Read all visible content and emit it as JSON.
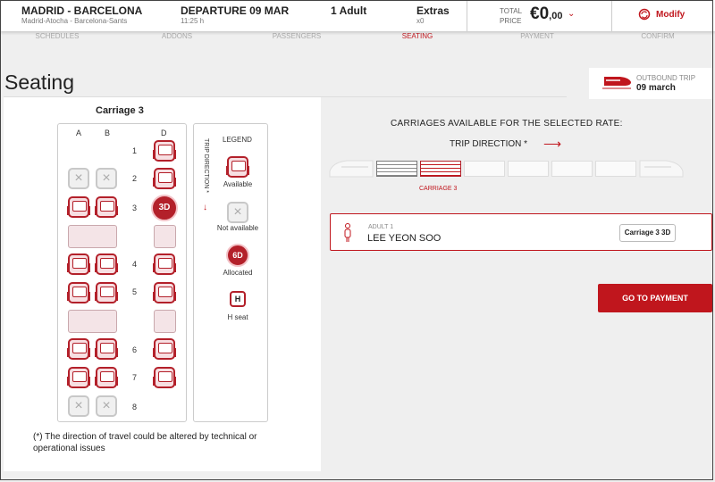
{
  "topbar": {
    "route_title": "MADRID - BARCELONA",
    "route_sub": "Madrid-Atocha - Barcelona-Sants",
    "departure_title": "DEPARTURE 09 MAR",
    "departure_time": "11:25 h",
    "passengers": "1 Adult",
    "extras_title": "Extras",
    "extras_count": "x0",
    "total_label_1": "TOTAL",
    "total_label_2": "PRICE",
    "price_main": "€0",
    "price_cents": ",00",
    "modify_label": "Modify"
  },
  "steps": [
    "SCHEDULES",
    "ADDONS",
    "PASSENGERS",
    "SEATING",
    "PAYMENT",
    "CONFIRM"
  ],
  "active_step": "SEATING",
  "page": {
    "title": "Seating",
    "outbound_label": "OUTBOUND TRIP",
    "outbound_date": "09 march"
  },
  "seatmap": {
    "carriage_title": "Carriage 3",
    "columns": [
      "A",
      "B",
      "D"
    ],
    "rows": [
      "1",
      "2",
      "3",
      "4",
      "5",
      "6",
      "7",
      "8"
    ],
    "allocated_seat": "3D"
  },
  "legend": {
    "title": "LEGEND",
    "trip_direction": "TRIP DIRECTION *",
    "available": "Available",
    "not_available": "Not available",
    "allocated_sample": "6D",
    "allocated": "Allocated",
    "h_sample": "H",
    "h_seat": "H seat"
  },
  "note": "(*) The direction of travel could be altered by technical or operational issues",
  "carriages": {
    "title": "CARRIAGES AVAILABLE FOR THE SELECTED RATE:",
    "trip_direction": "TRIP DIRECTION *",
    "selected_label": "CARRIAGE 3"
  },
  "passenger": {
    "type": "ADULT 1",
    "name": "LEE YEON SOO",
    "seat": "Carriage 3  3D"
  },
  "go_to_payment": "GO TO PAYMENT",
  "colors": {
    "accent": "#c0161d",
    "seat_fill": "#f7dfe2"
  }
}
